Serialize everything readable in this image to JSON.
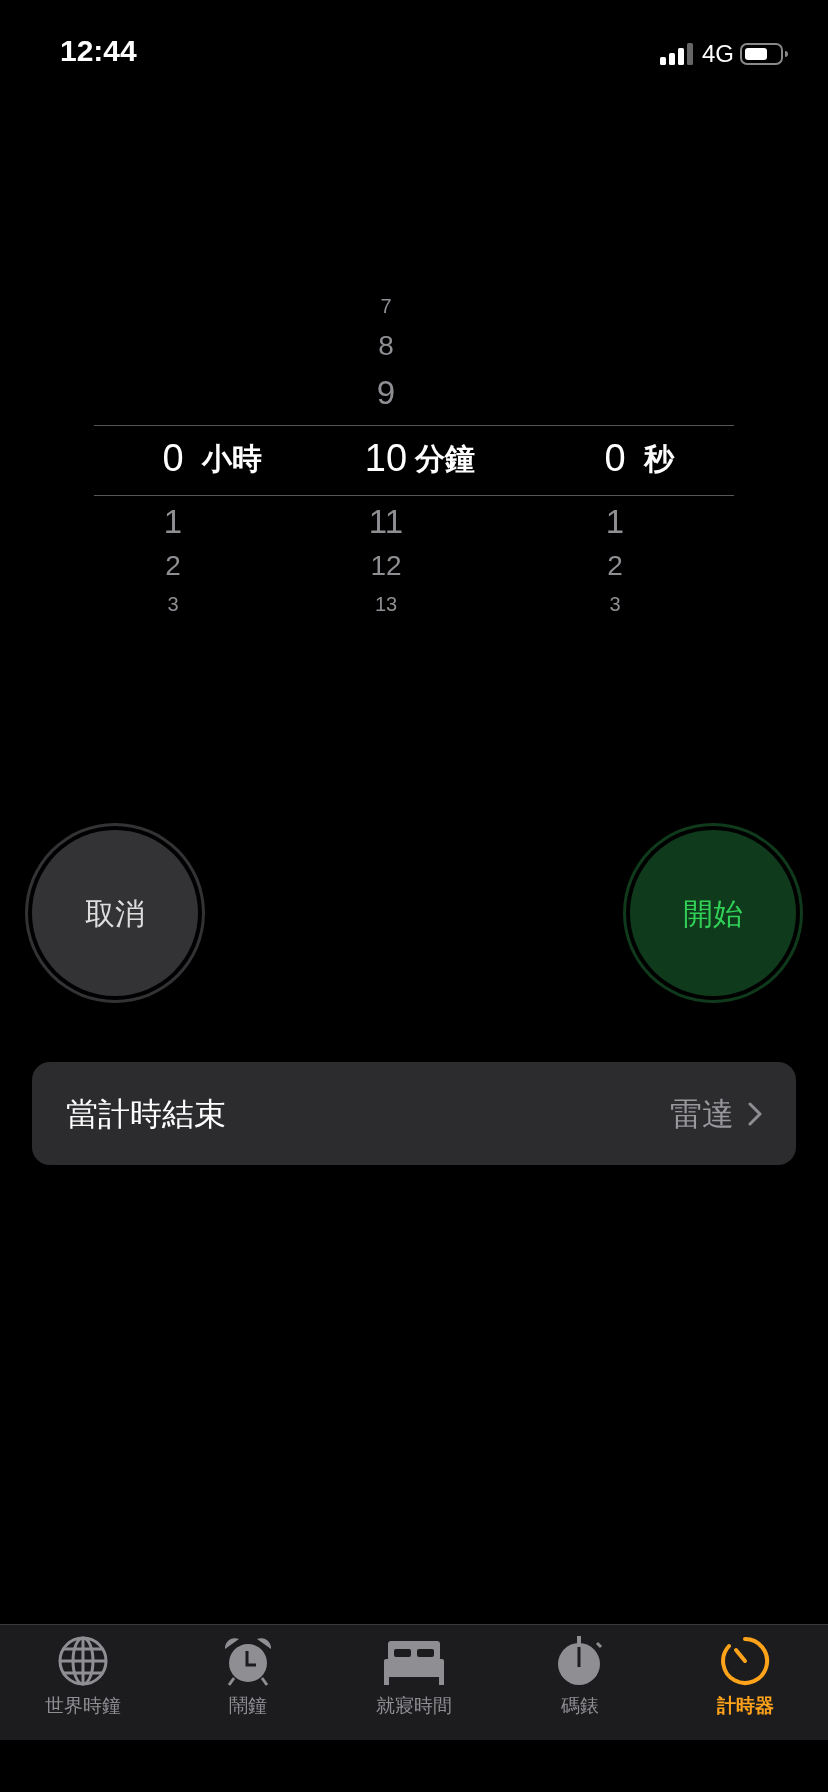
{
  "status_bar": {
    "time": "12:44",
    "network": "4G"
  },
  "picker": [
    {
      "unit": "小時",
      "value": "0",
      "below": [
        "1",
        "2",
        "3"
      ]
    },
    {
      "unit": "分鐘",
      "above": [
        "7",
        "8",
        "9"
      ],
      "value": "10",
      "below": [
        "11",
        "12",
        "13"
      ]
    },
    {
      "unit": "秒",
      "value": "0",
      "below": [
        "1",
        "2",
        "3"
      ]
    }
  ],
  "buttons": [
    {
      "label": "取消",
      "kind": "cancel"
    },
    {
      "label": "開始",
      "kind": "start"
    }
  ],
  "setting": {
    "label": "當計時結束",
    "value": "雷達"
  },
  "tabs": [
    {
      "label": "世界時鐘",
      "kind": "globe",
      "selected": false
    },
    {
      "label": "鬧鐘",
      "kind": "alarm",
      "selected": false
    },
    {
      "label": "就寢時間",
      "kind": "bed",
      "selected": false
    },
    {
      "label": "碼錶",
      "kind": "stopwatch",
      "selected": false
    },
    {
      "label": "計時器",
      "kind": "timer",
      "selected": true
    }
  ]
}
